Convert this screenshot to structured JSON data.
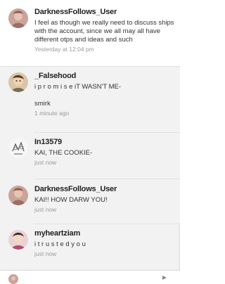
{
  "comments": [
    {
      "author": "DarknessFollows_User",
      "text": "I feel as though we really need to discuss ships with the account, since we all may all have different otps and ideas and such",
      "time": "Yesterday at 12:04 pm"
    },
    {
      "author": "_Falsehood",
      "text": "i p r o m i s e iT WASN'T ME-\n\nsmirk",
      "time": "1 minute ago"
    },
    {
      "author": "In13579",
      "text": "KAI, THE COOKIE-",
      "time": "just now"
    },
    {
      "author": "DarknessFollows_User",
      "text": "KAI!! HOW DARW YOU!",
      "time": "just now"
    },
    {
      "author": "myheartziam",
      "text": "i t r u s t e d y o u",
      "time": "just now"
    }
  ]
}
